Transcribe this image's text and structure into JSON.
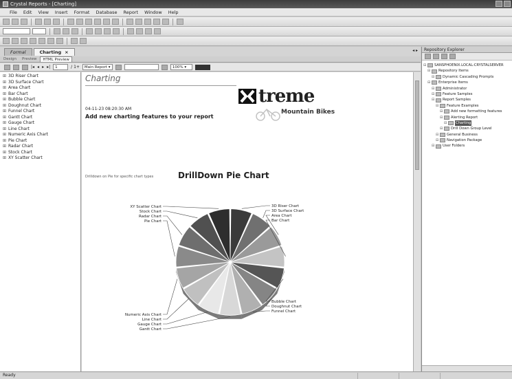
{
  "window": {
    "title": "Crystal Reports - [Charting]"
  },
  "menu": [
    "File",
    "Edit",
    "View",
    "Insert",
    "Format",
    "Database",
    "Report",
    "Window",
    "Help"
  ],
  "doc_tabs": [
    {
      "label": "Formal",
      "active": false
    },
    {
      "label": "Charting",
      "active": true,
      "close": "×"
    }
  ],
  "view_tabs": [
    {
      "label": "Design",
      "active": false
    },
    {
      "label": "Preview",
      "active": false
    },
    {
      "label": "HTML Preview",
      "active": true
    }
  ],
  "nav": {
    "page": "1",
    "page_of": "1+",
    "report_select": "Main Report",
    "zoom": "100%"
  },
  "group_tree": [
    "3D Riser Chart",
    "3D Surface Chart",
    "Area Chart",
    "Bar Chart",
    "Bubble Chart",
    "Doughnut Chart",
    "Funnel Chart",
    "Gantt Chart",
    "Gauge Chart",
    "Line Chart",
    "Numeric Axis Chart",
    "Pie Chart",
    "Radar Chart",
    "Stock Chart",
    "XY Scatter Chart"
  ],
  "report": {
    "title": "Charting",
    "date": "04-11-23",
    "time": "08:20:30 AM",
    "subtitle": "Add new charting features to your report",
    "logo_word": "treme",
    "logo_sub": "Mountain Bikes",
    "drill_hint": "Drilldown on Pie for specific chart types",
    "chart_title": "DrillDown Pie Chart"
  },
  "chart_data": {
    "type": "pie",
    "title": "DrillDown Pie Chart",
    "categories": [
      "3D Riser Chart",
      "3D Surface Chart",
      "Area Chart",
      "Bar Chart",
      "Bubble Chart",
      "Doughnut Chart",
      "Funnel Chart",
      "Gantt Chart",
      "Gauge Chart",
      "Line Chart",
      "Numeric Axis Chart",
      "Pie Chart",
      "Radar Chart",
      "Stock Chart",
      "XY Scatter Chart"
    ],
    "values": [
      1,
      1,
      1,
      1,
      1,
      1,
      1,
      1,
      1,
      1,
      1,
      1,
      1,
      1,
      1
    ],
    "slice_colors": [
      "#3a3a3a",
      "#707070",
      "#9a9a9a",
      "#c4c4c4",
      "#555555",
      "#858585",
      "#b0b0b0",
      "#d8d8d8",
      "#e8e8e8",
      "#c0c0c0",
      "#a5a5a5",
      "#8a8a8a",
      "#6e6e6e",
      "#505050",
      "#2e2e2e"
    ],
    "labels_shown": [
      "3D Riser Chart",
      "3D Surface Chart",
      "Area Chart",
      "Bar Chart",
      "Bubble Chart",
      "Doughnut Chart",
      "Funnel Chart",
      "Gantt Chart",
      "Gauge Chart",
      "Line Chart",
      "Numeric Axis Chart",
      "Pie Chart",
      "Radar Chart",
      "Stock Chart",
      "XY Scatter Chart"
    ]
  },
  "repository": {
    "title": "Repository Explorer",
    "items": [
      {
        "label": "SANSPHOENIX.LOCAL:CRYSTALSERVER",
        "selected": false
      },
      {
        "label": "Repository Items",
        "selected": false
      },
      {
        "label": "Dynamic Cascading Prompts",
        "selected": false
      },
      {
        "label": "Enterprise Items",
        "selected": false
      },
      {
        "label": "Administrator",
        "selected": false
      },
      {
        "label": "Feature Samples",
        "selected": false
      },
      {
        "label": "Report Samples",
        "selected": false
      },
      {
        "label": "Feature Examples",
        "selected": false
      },
      {
        "label": "Add new formatting features",
        "selected": false
      },
      {
        "label": "Alerting Report",
        "selected": false
      },
      {
        "label": "Charting",
        "selected": true
      },
      {
        "label": "Drill Down Group Level",
        "selected": false
      },
      {
        "label": "General Business",
        "selected": false
      },
      {
        "label": "Navigation Package",
        "selected": false
      },
      {
        "label": "User Folders",
        "selected": false
      }
    ]
  },
  "status": {
    "text": "Ready"
  }
}
